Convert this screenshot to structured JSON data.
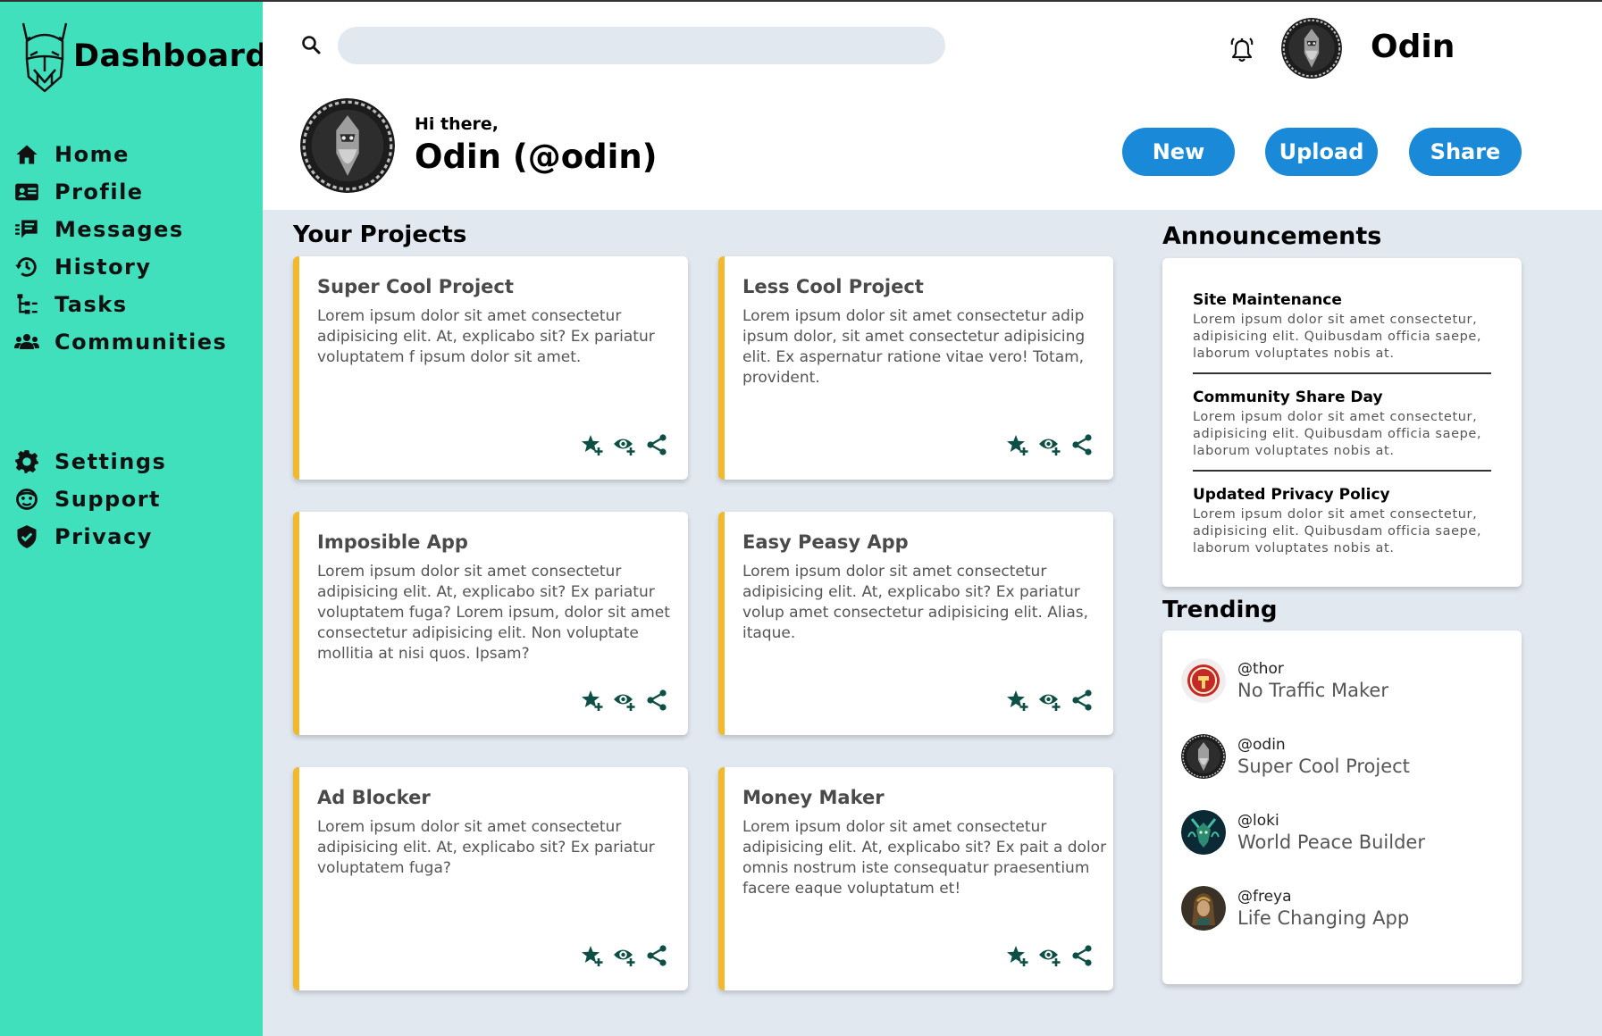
{
  "brand": {
    "title": "Dashboard",
    "logo_icon": "viking-helmet-icon"
  },
  "nav_primary": [
    {
      "label": "Home",
      "icon": "home-icon"
    },
    {
      "label": "Profile",
      "icon": "id-card-icon"
    },
    {
      "label": "Messages",
      "icon": "messages-icon"
    },
    {
      "label": "History",
      "icon": "history-icon"
    },
    {
      "label": "Tasks",
      "icon": "tasks-icon"
    },
    {
      "label": "Communities",
      "icon": "communities-icon"
    }
  ],
  "nav_secondary": [
    {
      "label": "Settings",
      "icon": "gear-icon"
    },
    {
      "label": "Support",
      "icon": "support-icon"
    },
    {
      "label": "Privacy",
      "icon": "shield-icon"
    }
  ],
  "header": {
    "search_placeholder": "",
    "username": "Odin",
    "greeting": "Hi there,",
    "profile_name": "Odin (@odin)",
    "buttons": {
      "new": "New",
      "upload": "Upload",
      "share": "Share"
    }
  },
  "projects": {
    "title": "Your Projects",
    "items": [
      {
        "title": "Super Cool Project",
        "text": "Lorem ipsum dolor sit amet consectetur adipisicing elit. At, explicabo sit? Ex pariatur voluptatem f ipsum dolor sit amet."
      },
      {
        "title": "Less Cool Project",
        "text": "Lorem ipsum dolor sit amet consectetur adip ipsum dolor, sit amet consectetur adipisicing elit. Ex aspernatur ratione vitae vero! Totam, provident."
      },
      {
        "title": "Imposible App",
        "text": "Lorem ipsum dolor sit amet consectetur adipisicing elit. At, explicabo sit? Ex pariatur voluptatem fuga? Lorem ipsum, dolor sit amet consectetur adipisicing elit. Non voluptate mollitia at nisi quos. Ipsam?"
      },
      {
        "title": "Easy Peasy App",
        "text": "Lorem ipsum dolor sit amet consectetur adipisicing elit. At, explicabo sit? Ex pariatur volup amet consectetur adipisicing elit. Alias, itaque."
      },
      {
        "title": "Ad Blocker",
        "text": "Lorem ipsum dolor sit amet consectetur adipisicing elit. At, explicabo sit? Ex pariatur voluptatem fuga?"
      },
      {
        "title": "Money Maker",
        "text": "Lorem ipsum dolor sit amet consectetur adipisicing elit. At, explicabo sit? Ex pait a dolor omnis nostrum iste consequatur praesentium facere eaque voluptatum et!"
      }
    ],
    "action_icons": [
      "star-plus-icon",
      "watch-plus-icon",
      "share-icon"
    ]
  },
  "announcements": {
    "title": "Announcements",
    "items": [
      {
        "title": "Site Maintenance",
        "text": "Lorem ipsum dolor sit amet consectetur, adipisicing elit. Quibusdam officia saepe, laborum voluptates nobis at."
      },
      {
        "title": "Community Share Day",
        "text": "Lorem ipsum dolor sit amet consectetur, adipisicing elit. Quibusdam officia saepe, laborum voluptates nobis at."
      },
      {
        "title": "Updated Privacy Policy",
        "text": "Lorem ipsum dolor sit amet consectetur, adipisicing elit. Quibusdam officia saepe, laborum voluptates nobis at."
      }
    ]
  },
  "trending": {
    "title": "Trending",
    "items": [
      {
        "handle": "@thor",
        "project": "No Traffic Maker"
      },
      {
        "handle": "@odin",
        "project": "Super Cool Project"
      },
      {
        "handle": "@loki",
        "project": "World Peace Builder"
      },
      {
        "handle": "@freya",
        "project": "Life Changing App"
      }
    ]
  },
  "colors": {
    "sidebar": "#40e0bc",
    "accent_button": "#1a8ad8",
    "card_border": "#f2b92c",
    "icon_dark_green": "#0e4f45",
    "background": "#e2e8f0"
  }
}
